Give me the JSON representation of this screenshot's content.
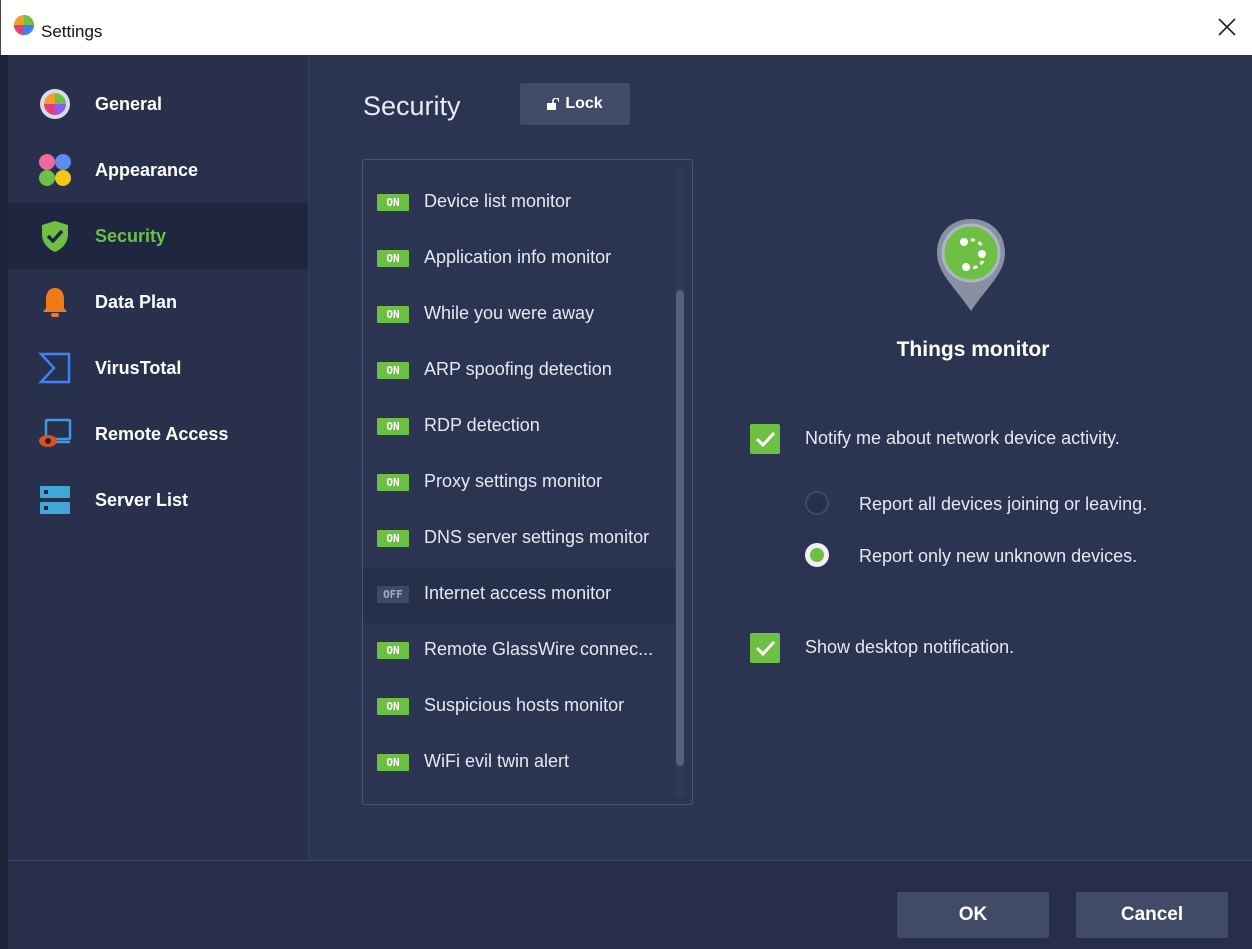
{
  "window": {
    "title": "Settings"
  },
  "sidebar": {
    "items": [
      {
        "label": "General",
        "icon": "general-icon"
      },
      {
        "label": "Appearance",
        "icon": "appearance-icon"
      },
      {
        "label": "Security",
        "icon": "shield-check-icon",
        "active": true
      },
      {
        "label": "Data Plan",
        "icon": "bell-icon"
      },
      {
        "label": "VirusTotal",
        "icon": "sigma-icon"
      },
      {
        "label": "Remote Access",
        "icon": "monitor-eye-icon"
      },
      {
        "label": "Server List",
        "icon": "server-icon"
      }
    ]
  },
  "main": {
    "section_title": "Security",
    "lock_label": "Lock",
    "monitors": [
      {
        "label": "Device list monitor",
        "state": "ON"
      },
      {
        "label": "Application info monitor",
        "state": "ON"
      },
      {
        "label": "While you were away",
        "state": "ON"
      },
      {
        "label": "ARP spoofing detection",
        "state": "ON"
      },
      {
        "label": "RDP detection",
        "state": "ON"
      },
      {
        "label": "Proxy settings monitor",
        "state": "ON"
      },
      {
        "label": "DNS server settings monitor",
        "state": "ON"
      },
      {
        "label": "Internet access monitor",
        "state": "OFF"
      },
      {
        "label": "Remote GlassWire connec...",
        "state": "ON"
      },
      {
        "label": "Suspicious hosts monitor",
        "state": "ON"
      },
      {
        "label": "WiFi evil twin alert",
        "state": "ON"
      }
    ]
  },
  "detail": {
    "title": "Things monitor",
    "notify_label": "Notify me about network device activity.",
    "notify_checked": true,
    "report_all_label": "Report all devices joining or leaving.",
    "report_new_label": "Report only new unknown devices.",
    "report_selected": "new",
    "desktop_label": "Show desktop notification.",
    "desktop_checked": true
  },
  "footer": {
    "ok_label": "OK",
    "cancel_label": "Cancel"
  },
  "colors": {
    "accent": "#6dc044",
    "background": "#2b3451",
    "sidebar_active": "#1f2640"
  }
}
